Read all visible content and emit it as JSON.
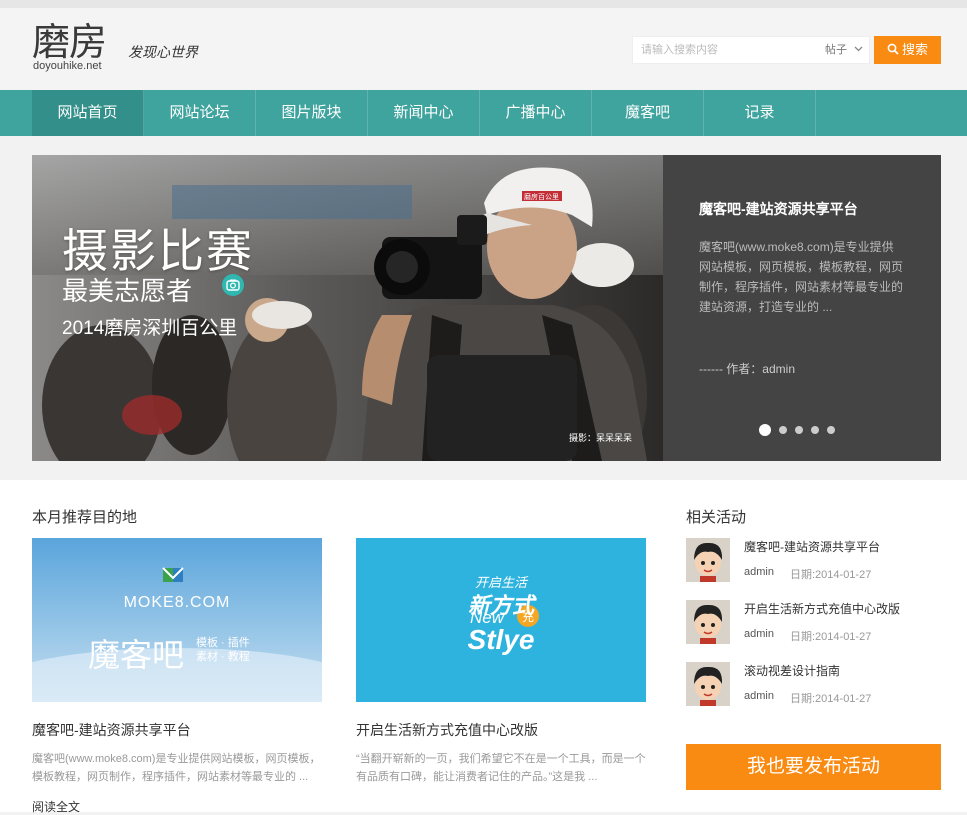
{
  "header": {
    "logo_cn": "磨房",
    "logo_en": "doyouhike.net",
    "slogan": "发现心世界",
    "search_placeholder": "请输入搜索内容",
    "search_type": "帖子",
    "search_button": "搜索"
  },
  "nav": {
    "items": [
      {
        "label": "网站首页",
        "active": true
      },
      {
        "label": "网站论坛"
      },
      {
        "label": "图片版块"
      },
      {
        "label": "新闻中心"
      },
      {
        "label": "广播中心"
      },
      {
        "label": "魔客吧"
      },
      {
        "label": "记录"
      }
    ]
  },
  "banner": {
    "title": "摄影比赛",
    "subtitle1": "最美志愿者",
    "subtitle2": "2014磨房深圳百公里",
    "cap_text": "磨房百公里",
    "photo_credit": "摄影：呆呆呆呆"
  },
  "info": {
    "title": "魔客吧-建站资源共享平台",
    "desc": "魔客吧(www.moke8.com)是专业提供网站模板，网页模板，模板教程，网页制作，程序插件，网站素材等最专业的建站资源，打造专业的 ...",
    "author": "------ 作者：admin",
    "dots": 5
  },
  "recommend": {
    "title": "本月推荐目的地",
    "cards": [
      {
        "brand": "MOKE8.COM",
        "big": "魔客吧",
        "tag_line1": "模板 · 插件",
        "tag_line2": "素材 · 教程",
        "title": "魔客吧-建站资源共享平台",
        "desc": "魔客吧(www.moke8.com)是专业提供网站模板，网页模板，模板教程，网页制作，程序插件，网站素材等最专业的 ..."
      },
      {
        "line1": "开启生活",
        "line2": "新方式",
        "line3": "New",
        "line4": "Stlye",
        "badge": "充",
        "title": "开启生活新方式充值中心改版",
        "desc": "“当翻开崭新的一页，我们希望它不在是一个工具，而是一个有品质有口碑，能让消费者记住的产品。”这是我 ..."
      }
    ]
  },
  "activities": {
    "title": "相关活动",
    "items": [
      {
        "title": "魔客吧-建站资源共享平台",
        "author": "admin",
        "date": "日期:2014-01-27"
      },
      {
        "title": "开启生活新方式充值中心改版",
        "author": "admin",
        "date": "日期:2014-01-27"
      },
      {
        "title": "滚动视差设计指南",
        "author": "admin",
        "date": "日期:2014-01-27"
      }
    ],
    "post_button": "我也要发布活动"
  },
  "footer_more": "阅读全文"
}
